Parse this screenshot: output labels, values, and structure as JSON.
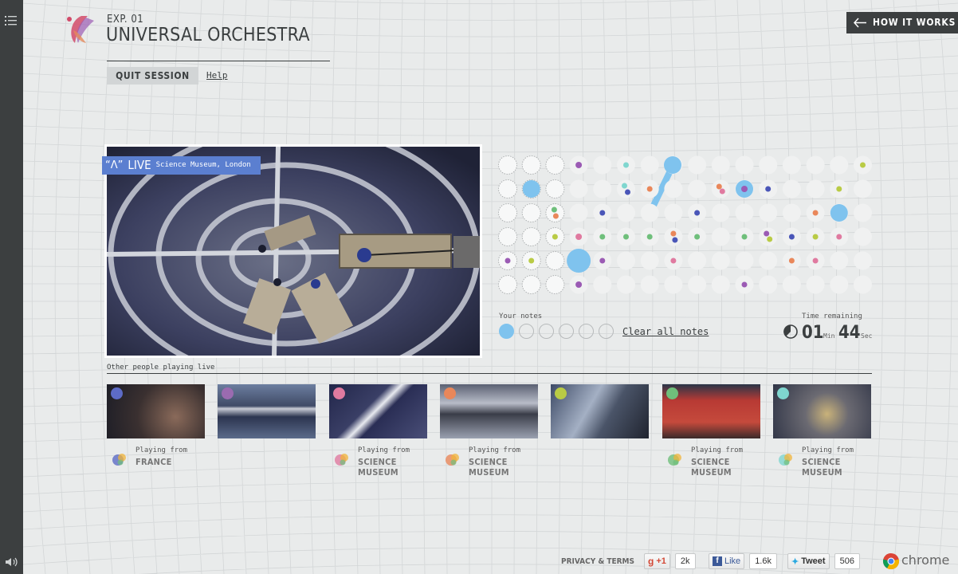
{
  "header": {
    "exp_label": "EXP. 01",
    "title": "UNIVERSAL ORCHESTRA",
    "quit_label": "QUIT SESSION",
    "help_label": "Help",
    "how_label": "HOW IT WORKS"
  },
  "live": {
    "icon": "“Λ”",
    "word": "LIVE",
    "location": "Science Museum, London"
  },
  "notes": {
    "your_notes_label": "Your notes",
    "slots_total": 6,
    "slots_filled": 1,
    "clear_label": "Clear all notes",
    "accent_color": "#7fc3ee"
  },
  "timer": {
    "label": "Time remaining",
    "minutes": "01",
    "min_unit": "Min",
    "seconds": "44",
    "sec_unit": "Sec"
  },
  "others": {
    "label": "Other people playing live",
    "players": [
      {
        "dot_color": "#5d6bc6",
        "from": "Playing from",
        "place": "FRANCE"
      },
      {
        "dot_color": "#9b6bb0",
        "from": "",
        "place": ""
      },
      {
        "dot_color": "#e07aa0",
        "from": "Playing from",
        "place": "SCIENCE MUSEUM"
      },
      {
        "dot_color": "#e9875a",
        "from": "Playing from",
        "place": "SCIENCE MUSEUM"
      },
      {
        "dot_color": "#b9cb45",
        "from": "",
        "place": ""
      },
      {
        "dot_color": "#6fbf7b",
        "from": "Playing from",
        "place": "SCIENCE MUSEUM"
      },
      {
        "dot_color": "#7fd6cf",
        "from": "Playing from",
        "place": "SCIENCE MUSEUM"
      }
    ]
  },
  "footer": {
    "privacy_label": "PRIVACY & TERMS",
    "gplus_label": "+1",
    "gplus_count": "2k",
    "like_label": "Like",
    "like_count": "1.6k",
    "tweet_label": "Tweet",
    "tweet_count": "506",
    "chrome_label": "chrome"
  },
  "icons": [
    "menu-icon",
    "sound-icon",
    "logo-icon",
    "arrow-left-icon",
    "timer-icon",
    "chrome-icon",
    "facebook-icon",
    "twitter-icon",
    "gplus-icon"
  ]
}
